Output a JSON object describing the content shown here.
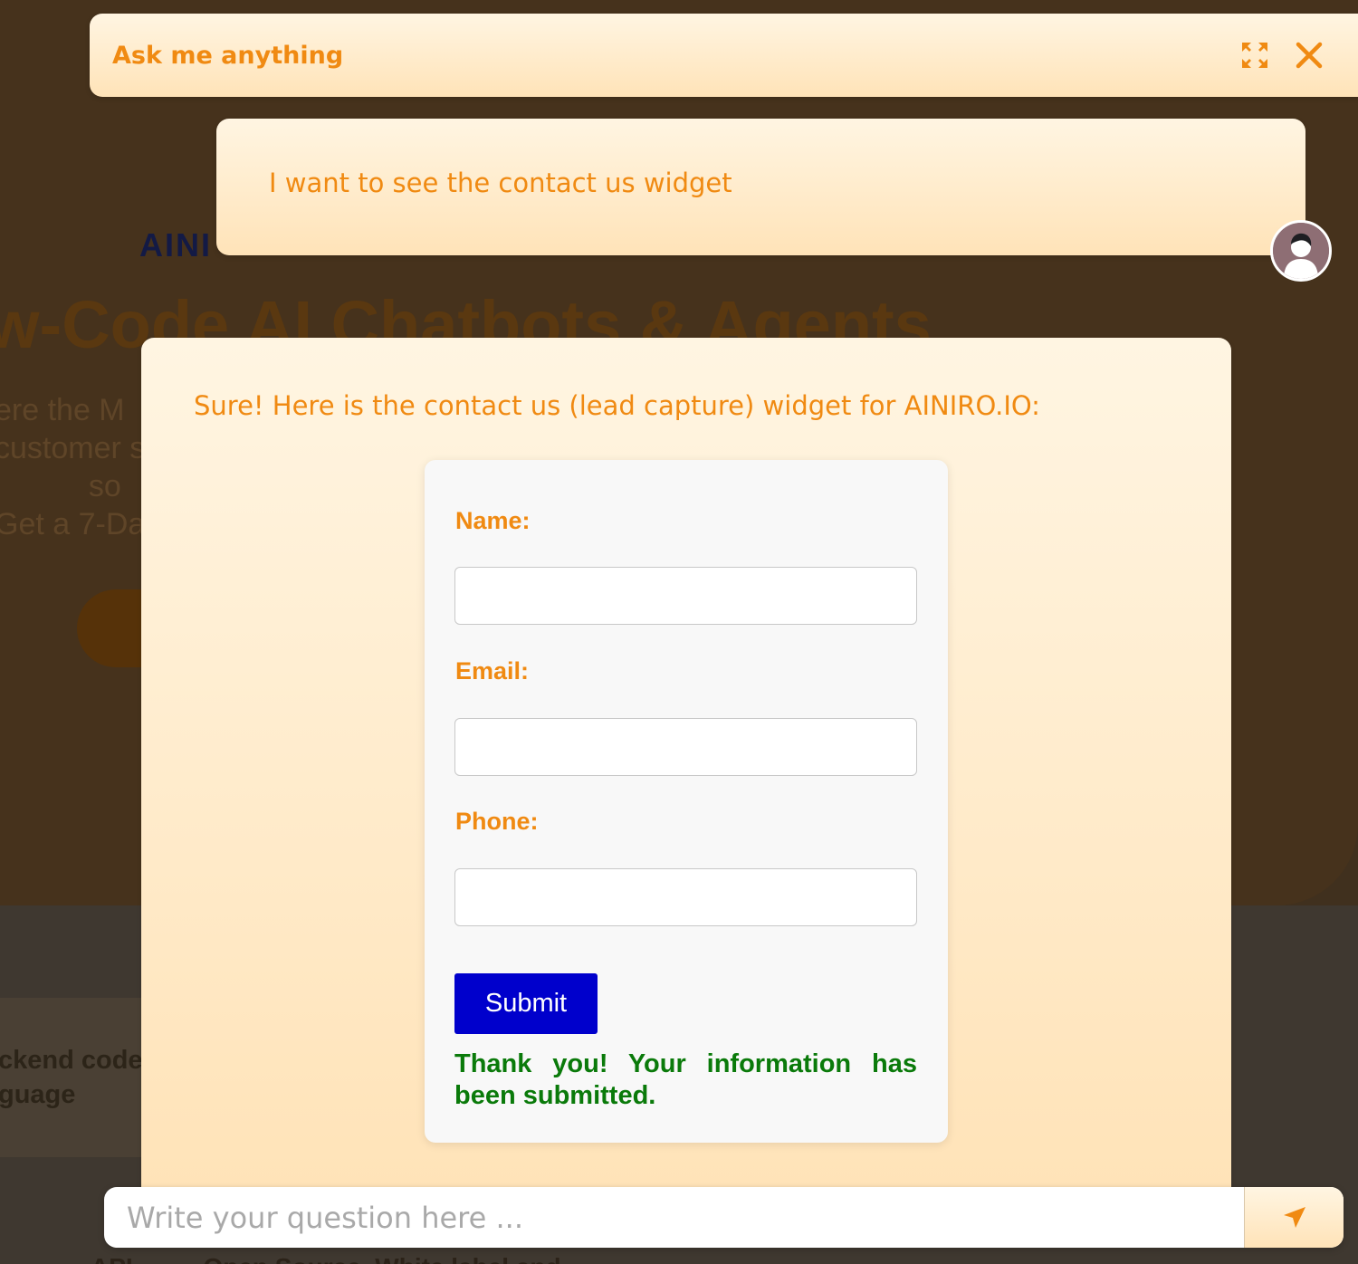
{
  "colors": {
    "accent_orange": "#f08a12",
    "submit_blue": "#0000cc",
    "success_green": "#0a7a0a",
    "bubble_light": "#fff5e2",
    "bubble_dark": "#ffe3b8"
  },
  "background_page": {
    "logo": "AINI",
    "heading": "w-Code AI Chatbots & Agents",
    "subtext": "ere the M\ncustomer s\n           so\nGet a 7-Da",
    "card_text": "ckend code\nguage",
    "bottom_text": "API          Open Source  White label and"
  },
  "chat": {
    "title": "Ask me anything",
    "expand_icon": "expand-arrows-icon",
    "close_icon": "close-icon",
    "messages": [
      {
        "role": "user",
        "text": "I want to see the contact us widget"
      },
      {
        "role": "assistant",
        "text": "Sure! Here is the contact us (lead capture) widget for AINIRO.IO:"
      }
    ],
    "user_avatar_icon": "user-avatar-icon"
  },
  "lead_form": {
    "name_label": "Name:",
    "name_value": "",
    "email_label": "Email:",
    "email_value": "",
    "phone_label": "Phone:",
    "phone_value": "",
    "submit_label": "Submit",
    "success_message": "Thank you! Your information has been submitted."
  },
  "input_bar": {
    "placeholder": "Write your question here ...",
    "send_icon": "send-arrow-icon"
  }
}
